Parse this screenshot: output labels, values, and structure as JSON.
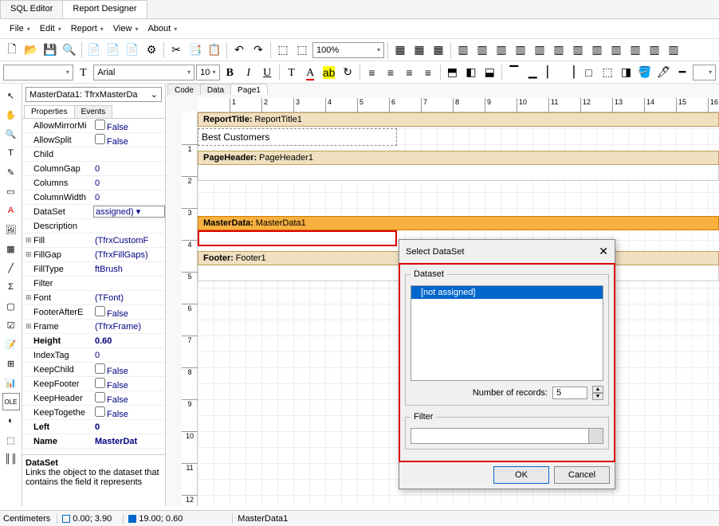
{
  "topTabs": {
    "sql": "SQL Editor",
    "rd": "Report Designer"
  },
  "menus": {
    "file": "File",
    "edit": "Edit",
    "report": "Report",
    "view": "View",
    "about": "About"
  },
  "toolbar2": {
    "zoom": "100%",
    "font": "Arial",
    "size": "10"
  },
  "canvasTabs": {
    "code": "Code",
    "data": "Data",
    "page1": "Page1"
  },
  "objCombo": "MasterData1: TfrxMasterDa",
  "propTabs": {
    "props": "Properties",
    "events": "Events"
  },
  "props": [
    {
      "exp": "",
      "name": "AllowMirrorMi",
      "val": "False",
      "chk": true
    },
    {
      "exp": "",
      "name": "AllowSplit",
      "val": "False",
      "chk": true
    },
    {
      "exp": "",
      "name": "Child",
      "val": ""
    },
    {
      "exp": "",
      "name": "ColumnGap",
      "val": "0"
    },
    {
      "exp": "",
      "name": "Columns",
      "val": "0"
    },
    {
      "exp": "",
      "name": "ColumnWidth",
      "val": "0"
    },
    {
      "exp": "",
      "name": "DataSet",
      "val": "assigned)",
      "sel": true,
      "dd": true
    },
    {
      "exp": "",
      "name": "Description",
      "val": ""
    },
    {
      "exp": "⊞",
      "name": "Fill",
      "val": "(TfrxCustomF"
    },
    {
      "exp": "⊞",
      "name": "FillGap",
      "val": "(TfrxFillGaps)"
    },
    {
      "exp": "",
      "name": "FillType",
      "val": "ftBrush"
    },
    {
      "exp": "",
      "name": "Filter",
      "val": ""
    },
    {
      "exp": "⊞",
      "name": "Font",
      "val": "(TFont)"
    },
    {
      "exp": "",
      "name": "FooterAfterE",
      "val": "False",
      "chk": true
    },
    {
      "exp": "⊞",
      "name": "Frame",
      "val": "(TfrxFrame)"
    },
    {
      "exp": "",
      "name": "Height",
      "val": "0.60",
      "bold": true
    },
    {
      "exp": "",
      "name": "IndexTag",
      "val": "0"
    },
    {
      "exp": "",
      "name": "KeepChild",
      "val": "False",
      "chk": true
    },
    {
      "exp": "",
      "name": "KeepFooter",
      "val": "False",
      "chk": true
    },
    {
      "exp": "",
      "name": "KeepHeader",
      "val": "False",
      "chk": true
    },
    {
      "exp": "",
      "name": "KeepTogethe",
      "val": "False",
      "chk": true
    },
    {
      "exp": "",
      "name": "Left",
      "val": "0",
      "bold": true
    },
    {
      "exp": "",
      "name": "Name",
      "val": "MasterDat",
      "bold": true
    }
  ],
  "propDesc": {
    "title": "DataSet",
    "text": "Links the object to the dataset that contains the field it represents"
  },
  "bands": {
    "rt_label": "ReportTitle:",
    "rt_name": "ReportTitle1",
    "title_text": "Best Customers",
    "ph_label": "PageHeader:",
    "ph_name": "PageHeader1",
    "md_label": "MasterData:",
    "md_name": "MasterData1",
    "ft_label": "Footer:",
    "ft_name": "Footer1"
  },
  "dialog": {
    "title": "Select DataSet",
    "ds_legend": "Dataset",
    "ds_item": "[not assigned]",
    "num_label": "Number of records:",
    "num_value": "5",
    "flt_legend": "Filter",
    "ok": "OK",
    "cancel": "Cancel"
  },
  "status": {
    "units": "Centimeters",
    "pos": "0.00; 3.90",
    "size": "19.00; 0.60",
    "obj": "MasterData1"
  }
}
